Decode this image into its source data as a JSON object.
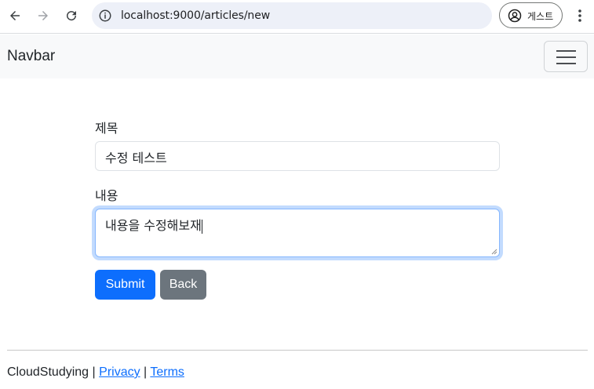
{
  "browser": {
    "url": "localhost:9000/articles/new",
    "profile_label": "게스트"
  },
  "navbar": {
    "brand": "Navbar"
  },
  "form": {
    "title_label": "제목",
    "title_value": "수정 테스트",
    "content_label": "내용",
    "content_value": "내용을 수정해보재",
    "submit_label": "Submit",
    "back_label": "Back"
  },
  "footer": {
    "brand": "CloudStudying",
    "separator": "|",
    "privacy": "Privacy",
    "terms": "Terms"
  },
  "colors": {
    "primary": "#0d6efd",
    "secondary": "#6c757d",
    "navbar_bg": "#f8f9fa"
  }
}
